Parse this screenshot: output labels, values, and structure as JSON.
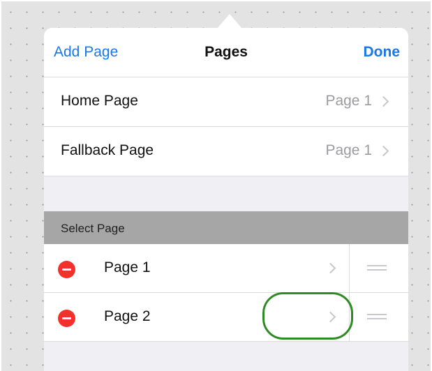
{
  "navbar": {
    "left_button": "Add Page",
    "title": "Pages",
    "right_button": "Done"
  },
  "settings_rows": [
    {
      "label": "Home Page",
      "value": "Page 1"
    },
    {
      "label": "Fallback Page",
      "value": "Page 1"
    }
  ],
  "section": {
    "header": "Select Page",
    "pages": [
      {
        "label": "Page 1"
      },
      {
        "label": "Page 2"
      }
    ]
  },
  "colors": {
    "accent": "#1a78e8",
    "delete": "#f0312c",
    "section_header": "#a6a6a6",
    "highlight": "#2e8b23"
  },
  "icons": [
    "chevron-right-icon",
    "delete-minus-icon",
    "reorder-handle-icon",
    "popover-arrow"
  ]
}
